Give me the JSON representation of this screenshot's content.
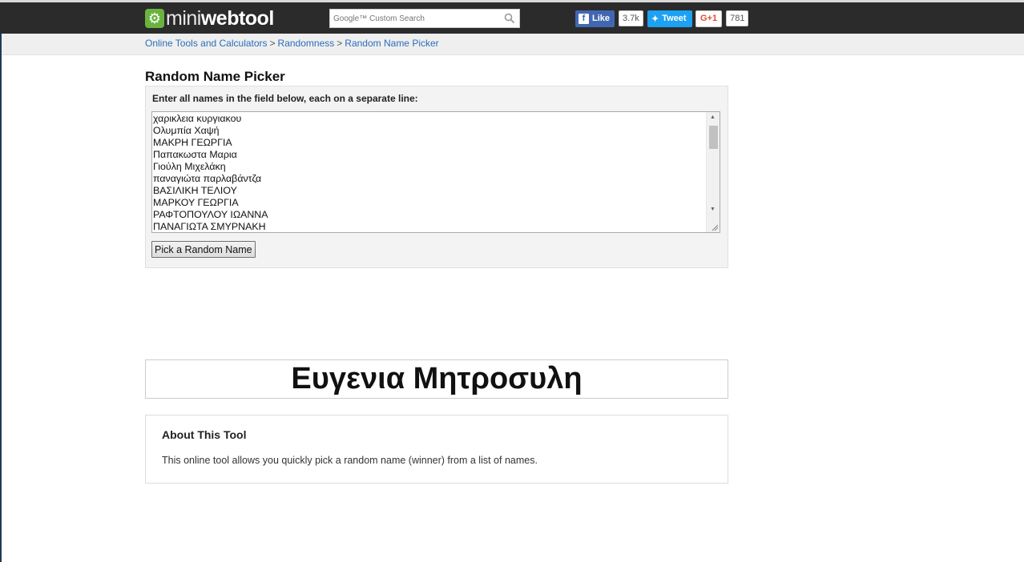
{
  "header": {
    "logo_light": "mini",
    "logo_bold": "webtool",
    "logo_icon": "gear-icon",
    "search": {
      "brand": "Google™",
      "placeholder": "Custom Search"
    },
    "social": {
      "facebook": {
        "label": "Like",
        "count": "3.7k"
      },
      "twitter": {
        "label": "Tweet"
      },
      "googleplus": {
        "label": "G+1",
        "count": "781"
      }
    }
  },
  "breadcrumb": {
    "items": [
      "Online Tools and Calculators",
      "Randomness",
      "Random Name Picker"
    ],
    "separator": ">"
  },
  "main": {
    "title": "Random Name Picker",
    "instruction": "Enter all names in the field below, each on a separate line:",
    "names": [
      "χαρικλεια κυργιακου",
      "Ολυμπία Χαψή",
      "ΜΑΚΡΗ ΓΕΩΡΓΙΑ",
      "Παπακωστα Μαρια",
      "Γιούλη Μιχελάκη",
      "παναγιώτα παρλαβάντζα",
      "ΒΑΣΙΛΙΚΗ ΤΕΛΙΟΥ",
      "ΜΑΡΚΟΥ ΓΕΩΡΓΙΑ",
      "ΡΑΦΤΟΠΟΥΛΟΥ ΙΩΑΝΝΑ",
      "ΠΑΝΑΓΙΩΤΑ ΣΜΥΡΝΑΚΗ"
    ],
    "pick_button": "Pick a Random Name",
    "result": "Ευγενια Μητροσυλη"
  },
  "about": {
    "title": "About This Tool",
    "text": "This online tool allows you quickly pick a random name (winner) from a list of names."
  },
  "colors": {
    "header_bg": "#2b2b2b",
    "logo_green": "#6ab43e",
    "link": "#2a6ebb",
    "facebook": "#4267b2",
    "twitter": "#1da1f2",
    "googleplus": "#dd4b39"
  }
}
